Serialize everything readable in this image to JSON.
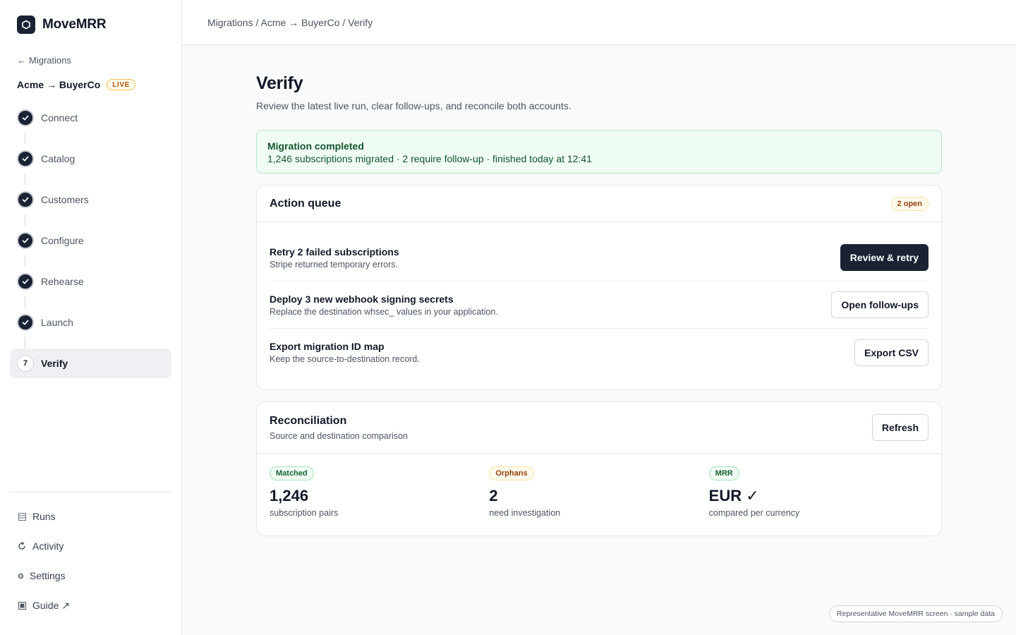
{
  "app": {
    "name": "MoveMRR"
  },
  "sidebar": {
    "back_label": "Migrations",
    "project_name": "Acme → BuyerCo",
    "live_badge": "LIVE",
    "steps": [
      {
        "label": "Connect",
        "state": "done"
      },
      {
        "label": "Catalog",
        "state": "done"
      },
      {
        "label": "Customers",
        "state": "done"
      },
      {
        "label": "Configure",
        "state": "done"
      },
      {
        "label": "Rehearse",
        "state": "done"
      },
      {
        "label": "Launch",
        "state": "done"
      },
      {
        "number": "7",
        "label": "Verify",
        "state": "active"
      }
    ],
    "links": [
      {
        "label": "Runs",
        "icon": "list-icon"
      },
      {
        "label": "Activity",
        "icon": "refresh-icon"
      },
      {
        "label": "Settings",
        "icon": "gear-icon"
      },
      {
        "label": "Guide ↗",
        "icon": "book-icon"
      }
    ]
  },
  "header": {
    "breadcrumb": "Migrations / Acme → BuyerCo / Verify"
  },
  "page": {
    "title": "Verify",
    "subtitle": "Review the latest live run, clear follow-ups, and reconcile both accounts."
  },
  "banner": {
    "title": "Migration completed",
    "detail": "1,246 subscriptions migrated · 2 require follow-up · finished today at 12:41"
  },
  "action_queue": {
    "title": "Action queue",
    "badge": "2 open",
    "items": [
      {
        "title": "Retry 2 failed subscriptions",
        "desc": "Stripe returned temporary errors.",
        "button": "Review & retry",
        "primary": true
      },
      {
        "title": "Deploy 3 new webhook signing secrets",
        "desc": "Replace the destination whsec_ values in your application.",
        "button": "Open follow-ups",
        "primary": false
      },
      {
        "title": "Export migration ID map",
        "desc": "Keep the source-to-destination record.",
        "button": "Export CSV",
        "primary": false
      }
    ]
  },
  "reconciliation": {
    "title": "Reconciliation",
    "subtitle": "Source and destination comparison",
    "refresh_label": "Refresh",
    "stats": [
      {
        "badge": "Matched",
        "value": "1,246",
        "label": "subscription pairs",
        "tone": "green"
      },
      {
        "badge": "Orphans",
        "value": "2",
        "label": "need investigation",
        "tone": "amber"
      },
      {
        "badge": "MRR",
        "value": "EUR ✓",
        "label": "compared per currency",
        "tone": "green"
      }
    ]
  },
  "footer_note": "Representative MoveMRR screen · sample data",
  "colors": {
    "accent_dark": "#1a2233",
    "success_bg": "#f0fdf4",
    "warning": "#b45309"
  }
}
